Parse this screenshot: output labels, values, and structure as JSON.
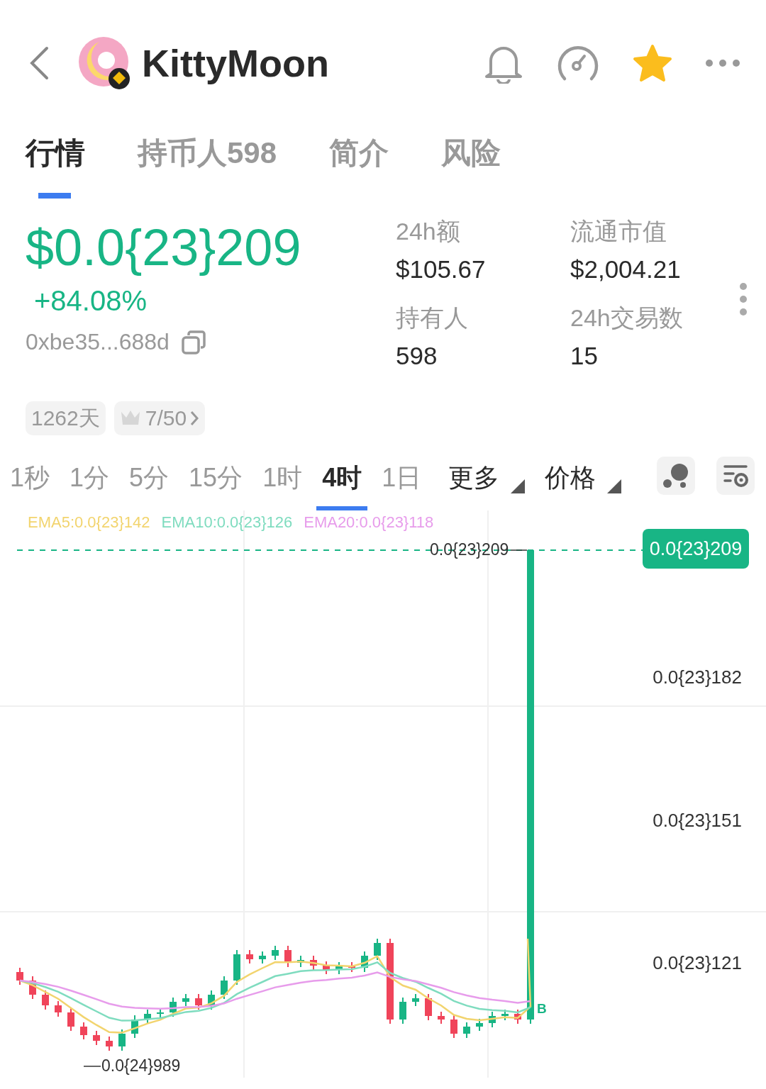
{
  "header": {
    "title": "KittyMoon",
    "favorited": true
  },
  "tabs": [
    {
      "label": "行情",
      "selected": true
    },
    {
      "label": "持币人598",
      "selected": false
    },
    {
      "label": "简介",
      "selected": false
    },
    {
      "label": "风险",
      "selected": false
    }
  ],
  "price": {
    "value": "$0.0{23}209",
    "change": "+84.08%",
    "address": "0xbe35...688d"
  },
  "stats": [
    {
      "label": "24h额",
      "value": "$105.67"
    },
    {
      "label": "流通市值",
      "value": "$2,004.21"
    },
    {
      "label": "持有人",
      "value": "598"
    },
    {
      "label": "24h交易数",
      "value": "15"
    }
  ],
  "age": "1262天",
  "rank": "7/50",
  "intervals": [
    {
      "label": "1秒",
      "selected": false
    },
    {
      "label": "1分",
      "selected": false
    },
    {
      "label": "5分",
      "selected": false
    },
    {
      "label": "15分",
      "selected": false
    },
    {
      "label": "1时",
      "selected": false
    },
    {
      "label": "4时",
      "selected": true
    },
    {
      "label": "1日",
      "selected": false
    }
  ],
  "dropdowns": [
    "更多",
    "价格"
  ],
  "chart": {
    "ema": [
      {
        "label": "EMA5:0.0{23}142",
        "color": "#f2d46e"
      },
      {
        "label": "EMA10:0.0{23}126",
        "color": "#7fdcbf"
      },
      {
        "label": "EMA20:0.0{23}118",
        "color": "#e79ceb"
      }
    ],
    "current_price": "0.0{23}209",
    "high_label": "0.0{23}209",
    "low_label": "0.0{24}989",
    "marker": "B",
    "axis_labels": [
      "0.0{23}182",
      "0.0{23}151",
      "0.0{23}121"
    ]
  }
}
